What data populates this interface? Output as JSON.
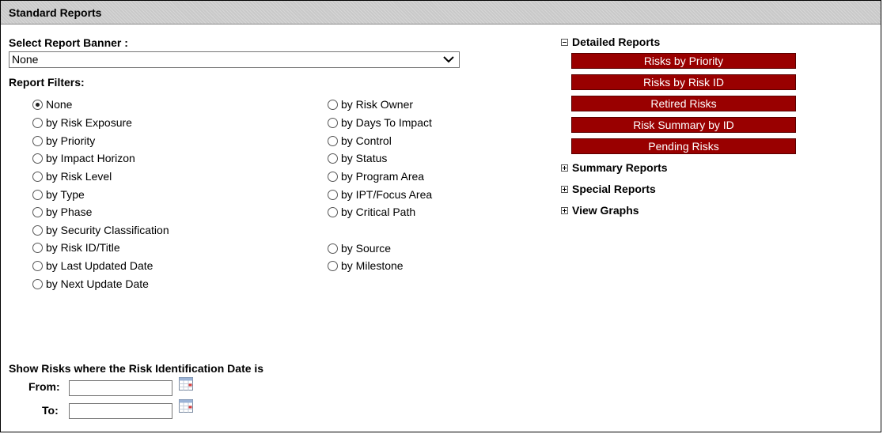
{
  "header": {
    "title": "Standard Reports"
  },
  "banner": {
    "label": "Select Report Banner :",
    "selected": "None"
  },
  "filters": {
    "label": "Report Filters:",
    "col1": [
      {
        "label": "None",
        "checked": true
      },
      {
        "label": "by Risk Exposure",
        "checked": false
      },
      {
        "label": "by Priority",
        "checked": false
      },
      {
        "label": "by Impact Horizon",
        "checked": false
      },
      {
        "label": "by Risk Level",
        "checked": false
      },
      {
        "label": "by Type",
        "checked": false
      },
      {
        "label": "by Phase",
        "checked": false
      },
      {
        "label": "by Security Classification",
        "checked": false
      },
      {
        "label": "by Risk ID/Title",
        "checked": false
      },
      {
        "label": "by Last Updated Date",
        "checked": false
      },
      {
        "label": "by Next Update Date",
        "checked": false
      }
    ],
    "col2": [
      {
        "label": "by Risk Owner",
        "checked": false
      },
      {
        "label": "by Days To Impact",
        "checked": false
      },
      {
        "label": "by Control",
        "checked": false
      },
      {
        "label": "by Status",
        "checked": false
      },
      {
        "label": "by Program Area",
        "checked": false
      },
      {
        "label": "by IPT/Focus Area",
        "checked": false
      },
      {
        "label": "by Critical Path",
        "checked": false
      },
      {
        "label": "by Source",
        "checked": false
      },
      {
        "label": "by Milestone",
        "checked": false
      }
    ]
  },
  "reports": {
    "detailed": {
      "label": "Detailed Reports",
      "expanded": true,
      "buttons": [
        "Risks by Priority",
        "Risks by Risk ID",
        "Retired Risks",
        "Risk Summary by ID",
        "Pending Risks"
      ]
    },
    "summary": {
      "label": "Summary Reports",
      "expanded": false
    },
    "special": {
      "label": "Special Reports",
      "expanded": false
    },
    "graphs": {
      "label": "View Graphs",
      "expanded": false
    }
  },
  "date_filter": {
    "title": "Show Risks where the Risk Identification Date is",
    "from_label": "From:",
    "to_label": "To:",
    "from_value": "",
    "to_value": ""
  },
  "colors": {
    "button_bg": "#990000",
    "button_text": "#ffffff"
  }
}
